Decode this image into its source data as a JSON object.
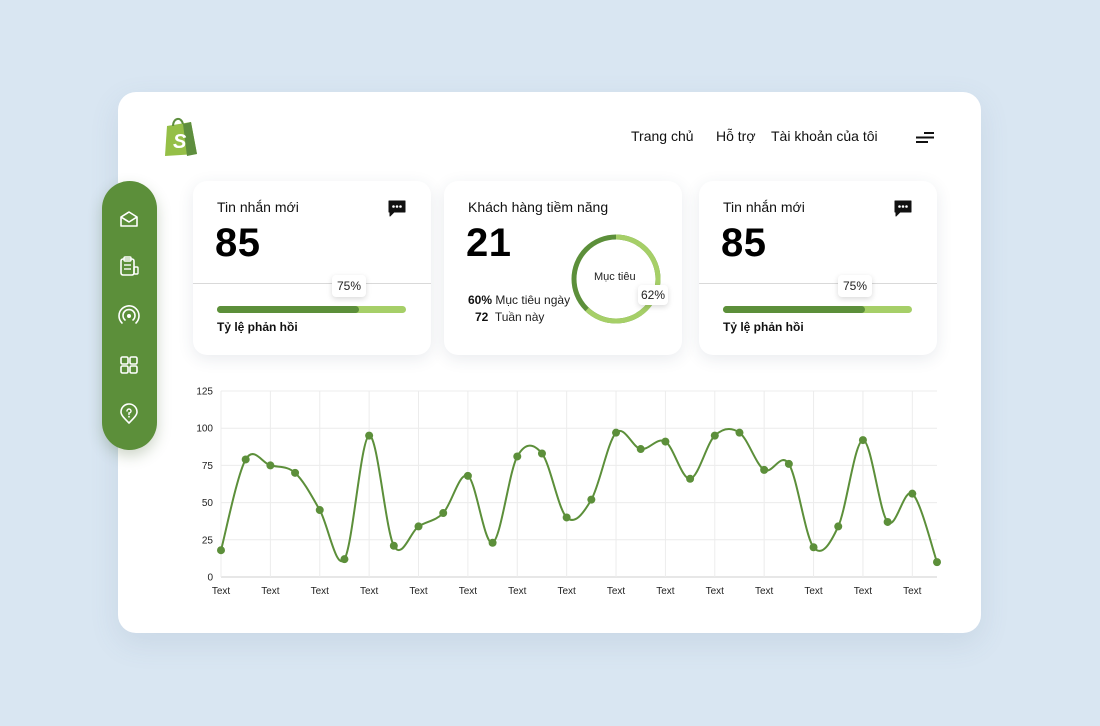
{
  "header": {
    "nav": [
      "Trang chủ",
      "Hỗ trợ",
      "Tài khoản của tôi"
    ],
    "logo_icon": "shopify-bag-icon",
    "menu_icon": "hamburger-menu-icon"
  },
  "sidebar": {
    "items": [
      {
        "icon": "mail-open-icon"
      },
      {
        "icon": "clipboard-icon"
      },
      {
        "icon": "broadcast-icon"
      },
      {
        "icon": "grid-apps-icon"
      },
      {
        "icon": "location-help-icon"
      }
    ],
    "color": "#5c8f3a"
  },
  "cards": [
    {
      "title": "Tin nhắn mới",
      "value": "85",
      "progress": 0.75,
      "progress_label": "75%",
      "footer": "Tỷ lệ phản hồi",
      "icon": "chat-icon"
    },
    {
      "title": "Khách hàng tiềm năng",
      "value": "21",
      "donut_label": "Mục tiêu",
      "donut_percent": "62%",
      "donut_fraction": 0.62,
      "stats": [
        {
          "value": "60%",
          "label": "Mục tiêu ngày"
        },
        {
          "value": "72",
          "label": "Tuần này"
        }
      ]
    },
    {
      "title": "Tin nhắn mới",
      "value": "85",
      "progress": 0.75,
      "progress_label": "75%",
      "footer": "Tỷ lệ phản hồi",
      "icon": "chat-icon"
    }
  ],
  "colors": {
    "accent_dark": "#5c8f3a",
    "accent_light": "#a6cf68",
    "background": "#d9e6f2"
  },
  "chart_data": {
    "type": "line",
    "title": "",
    "xlabel": "",
    "ylabel": "",
    "ylim": [
      0,
      125
    ],
    "yticks": [
      0,
      25,
      50,
      75,
      100,
      125
    ],
    "xtick_labels": [
      "Text",
      "Text",
      "Text",
      "Text",
      "Text",
      "Text",
      "Text",
      "Text",
      "Text",
      "Text",
      "Text",
      "Text",
      "Text",
      "Text",
      "Text"
    ],
    "grid": true,
    "series": [
      {
        "values": [
          18,
          79,
          75,
          70,
          45,
          12,
          95,
          21,
          34,
          43,
          68,
          23,
          81,
          83,
          40,
          52,
          97,
          86,
          91,
          66,
          95,
          97,
          72,
          76,
          20,
          34,
          92,
          37,
          56,
          10
        ]
      }
    ]
  }
}
